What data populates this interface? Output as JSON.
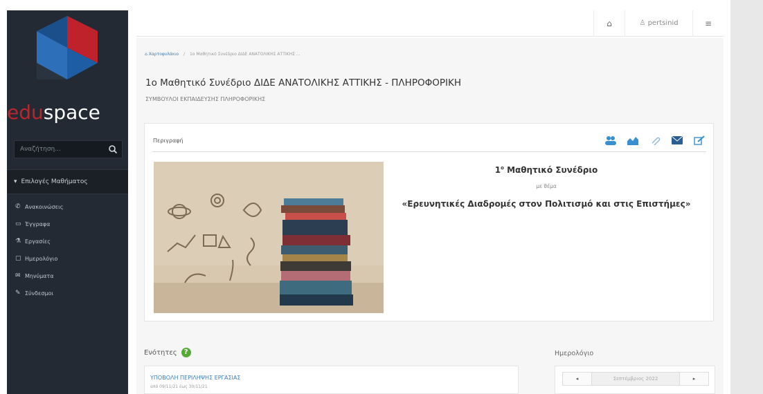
{
  "sidebar": {
    "logo": {
      "part1": "edu",
      "part2": "space"
    },
    "search_placeholder": "Αναζήτηση...",
    "menu_header": "Επιλογές Μαθήματος",
    "items": [
      {
        "label": "Ανακοινώσεις",
        "icon": "bullhorn-icon"
      },
      {
        "label": "Έγγραφα",
        "icon": "folder-icon"
      },
      {
        "label": "Εργασίες",
        "icon": "flask-icon"
      },
      {
        "label": "Ημερολόγιο",
        "icon": "calendar-icon"
      },
      {
        "label": "Μηνύματα",
        "icon": "envelope-icon"
      },
      {
        "label": "Σύνδεσμοι",
        "icon": "link-icon"
      }
    ]
  },
  "topbar": {
    "username": "pertsinid"
  },
  "breadcrumb": {
    "home": "Χαρτοφυλάκιο",
    "current": "1ο Μαθητικό Συνέδριο ΔΙΔΕ ΑΝΑΤΟΛΙΚΗΣ ΑΤΤΙΚΗΣ ..."
  },
  "course": {
    "title": "1ο Μαθητικό Συνέδριο ΔΙΔΕ ΑΝΑΤΟΛΙΚΗΣ ΑΤΤΙΚΗΣ - ΠΛΗΡΟΦΟΡΙΚΗ",
    "subtitle": "ΣΥΜΒΟΥΛΟΙ ΕΚΠΑΙΔΕΥΣΗΣ ΠΛΗΡΟΦΟΡΙΚΗΣ"
  },
  "description": {
    "label": "Περιγραφή",
    "heading_main": "1",
    "heading_sup": "ο",
    "heading_rest": " Μαθητικό Συνέδριο",
    "with_theme": "με θέμα",
    "theme": "«Ερευνητικές Διαδρομές στον Πολιτισμό και στις Επιστήμες»"
  },
  "units": {
    "header": "Ενότητες",
    "first_unit": "ΥΠΟΒΟΛΗ ΠΕΡΙΛΗΨΗΣ ΕΡΓΑΣΙΑΣ",
    "first_unit_date": "από 09/11/21 έως 30/11/21"
  },
  "calendar": {
    "header": "Ημερολόγιο",
    "prev": "◂",
    "next": "▸",
    "month": "Σεπτέμβριος 2022"
  },
  "colors": {
    "sidebar_bg": "#232a33",
    "brand_red": "#b8262e",
    "link_blue": "#3b7dbb",
    "help_green": "#56a936"
  }
}
